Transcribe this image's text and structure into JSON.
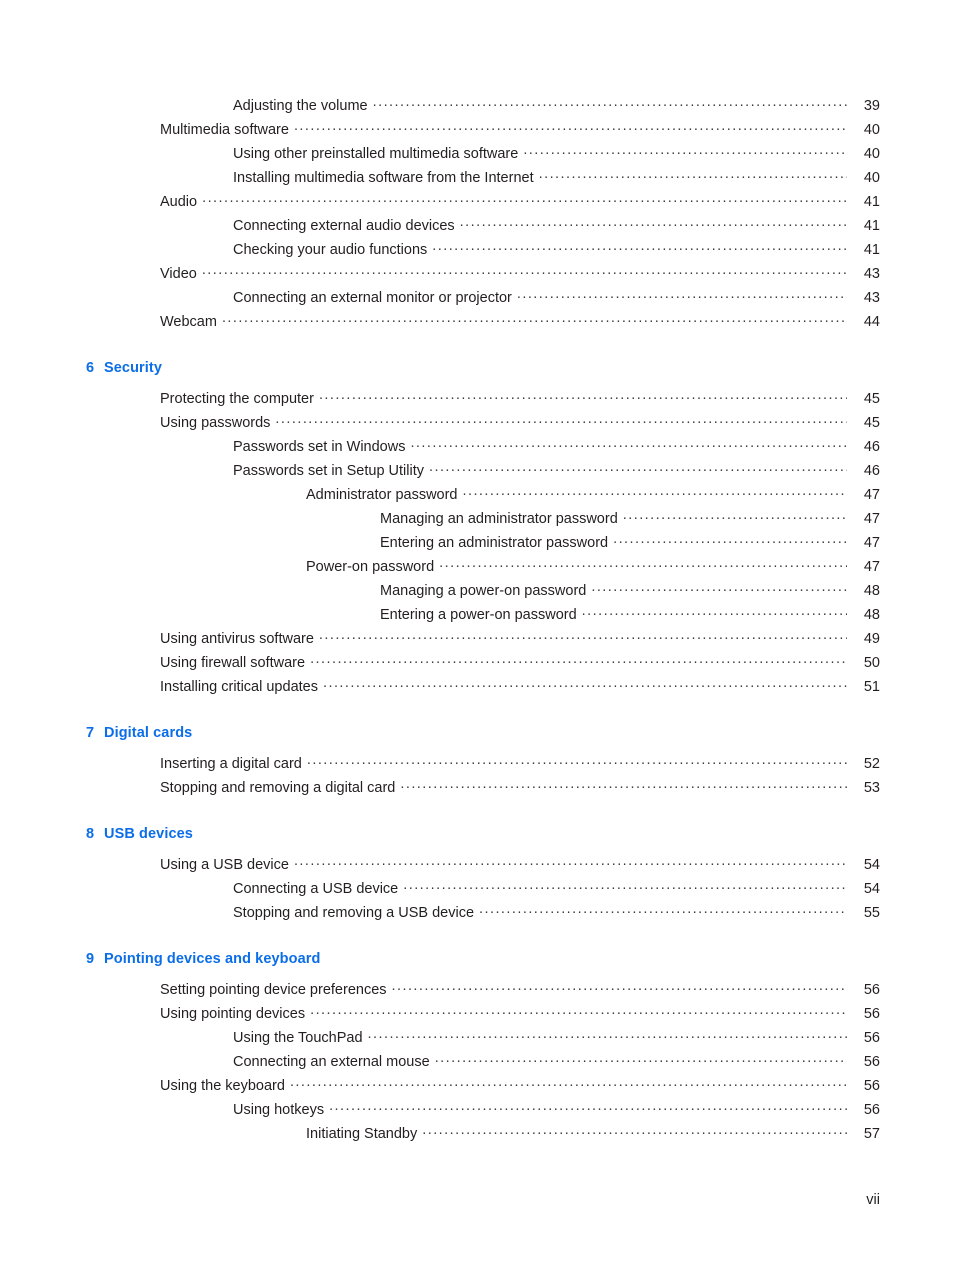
{
  "document": {
    "type": "table-of-contents",
    "folio": "vii",
    "accent_color": "#0b6ee8",
    "text_color": "#231f20"
  },
  "blocks": [
    {
      "kind": "entries",
      "entries": [
        {
          "level": 2,
          "text": "Adjusting the volume",
          "page": "39"
        },
        {
          "level": 1,
          "text": "Multimedia software",
          "page": "40"
        },
        {
          "level": 2,
          "text": "Using other preinstalled multimedia software",
          "page": "40"
        },
        {
          "level": 2,
          "text": "Installing multimedia software from the Internet",
          "page": "40"
        },
        {
          "level": 1,
          "text": "Audio",
          "page": "41"
        },
        {
          "level": 2,
          "text": "Connecting external audio devices",
          "page": "41"
        },
        {
          "level": 2,
          "text": "Checking your audio functions",
          "page": "41"
        },
        {
          "level": 1,
          "text": "Video",
          "page": "43"
        },
        {
          "level": 2,
          "text": "Connecting an external monitor or projector",
          "page": "43"
        },
        {
          "level": 1,
          "text": "Webcam",
          "page": "44"
        }
      ]
    },
    {
      "kind": "chapter",
      "number": "6",
      "title": "Security",
      "entries": [
        {
          "level": 1,
          "text": "Protecting the computer",
          "page": "45"
        },
        {
          "level": 1,
          "text": "Using passwords",
          "page": "45"
        },
        {
          "level": 2,
          "text": "Passwords set in Windows",
          "page": "46"
        },
        {
          "level": 2,
          "text": "Passwords set in Setup Utility",
          "page": "46"
        },
        {
          "level": 3,
          "text": "Administrator password",
          "page": "47"
        },
        {
          "level": 4,
          "text": "Managing an administrator password",
          "page": "47"
        },
        {
          "level": 4,
          "text": "Entering an administrator password",
          "page": "47"
        },
        {
          "level": 3,
          "text": "Power-on password",
          "page": "47"
        },
        {
          "level": 4,
          "text": "Managing a power-on password",
          "page": "48"
        },
        {
          "level": 4,
          "text": "Entering a power-on password",
          "page": "48"
        },
        {
          "level": 1,
          "text": "Using antivirus software",
          "page": "49"
        },
        {
          "level": 1,
          "text": "Using firewall software",
          "page": "50"
        },
        {
          "level": 1,
          "text": "Installing critical updates",
          "page": "51"
        }
      ]
    },
    {
      "kind": "chapter",
      "number": "7",
      "title": "Digital cards",
      "entries": [
        {
          "level": 1,
          "text": "Inserting a digital card",
          "page": "52"
        },
        {
          "level": 1,
          "text": "Stopping and removing a digital card",
          "page": "53"
        }
      ]
    },
    {
      "kind": "chapter",
      "number": "8",
      "title": "USB devices",
      "entries": [
        {
          "level": 1,
          "text": "Using a USB device",
          "page": "54"
        },
        {
          "level": 2,
          "text": "Connecting a USB device",
          "page": "54"
        },
        {
          "level": 2,
          "text": "Stopping and removing a USB device",
          "page": "55"
        }
      ]
    },
    {
      "kind": "chapter",
      "number": "9",
      "title": "Pointing devices and keyboard",
      "entries": [
        {
          "level": 1,
          "text": "Setting pointing device preferences",
          "page": "56"
        },
        {
          "level": 1,
          "text": "Using pointing devices",
          "page": "56"
        },
        {
          "level": 2,
          "text": "Using the TouchPad",
          "page": "56"
        },
        {
          "level": 2,
          "text": "Connecting an external mouse",
          "page": "56"
        },
        {
          "level": 1,
          "text": "Using the keyboard",
          "page": "56"
        },
        {
          "level": 2,
          "text": "Using hotkeys",
          "page": "56"
        },
        {
          "level": 3,
          "text": "Initiating Standby",
          "page": "57"
        }
      ]
    }
  ]
}
